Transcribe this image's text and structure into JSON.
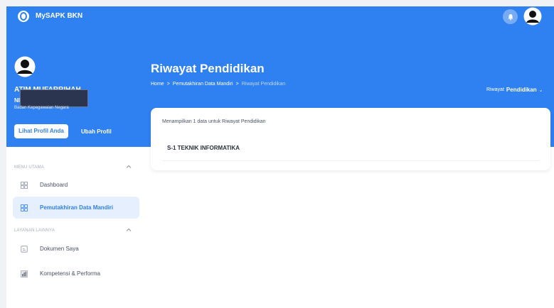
{
  "app": {
    "name": "MySAPK BKN"
  },
  "profile": {
    "name": "ATIM MUFARRIHAH",
    "nip_label": "NI",
    "org": "Badan Kepegawaian Negara",
    "view_button": "Lihat Profil Anda",
    "edit_button": "Ubah Profil"
  },
  "sidebar": {
    "section1": "MENU UTAMA",
    "section2": "LAYANAN LAINNYA",
    "items": [
      {
        "label": "Dashboard",
        "icon": "grid-icon"
      },
      {
        "label": "Pemutakhiran Data Mandiri",
        "icon": "grid-icon",
        "active": true
      },
      {
        "label": "Dokumen Saya",
        "icon": "document-icon"
      },
      {
        "label": "Kompetensi & Performa",
        "icon": "chart-icon"
      }
    ]
  },
  "page": {
    "title": "Riwayat Pendidikan",
    "breadcrumb": [
      "Home",
      ">",
      "Pemutakhiran Data Mandiri",
      ">",
      "Riwayat Pendidikan"
    ],
    "dropdown_prefix": "Riwayat",
    "dropdown_bold": "Pendidikan",
    "dropdown_caret": "⌄"
  },
  "card": {
    "info": "Menampilkan 1 data untuk Riwayat Pendidikan",
    "rows": [
      "S-1 TEKNIK INFORMATIKA"
    ]
  },
  "colors": {
    "primary": "#2f80f0",
    "active_bg": "#e6effd"
  }
}
